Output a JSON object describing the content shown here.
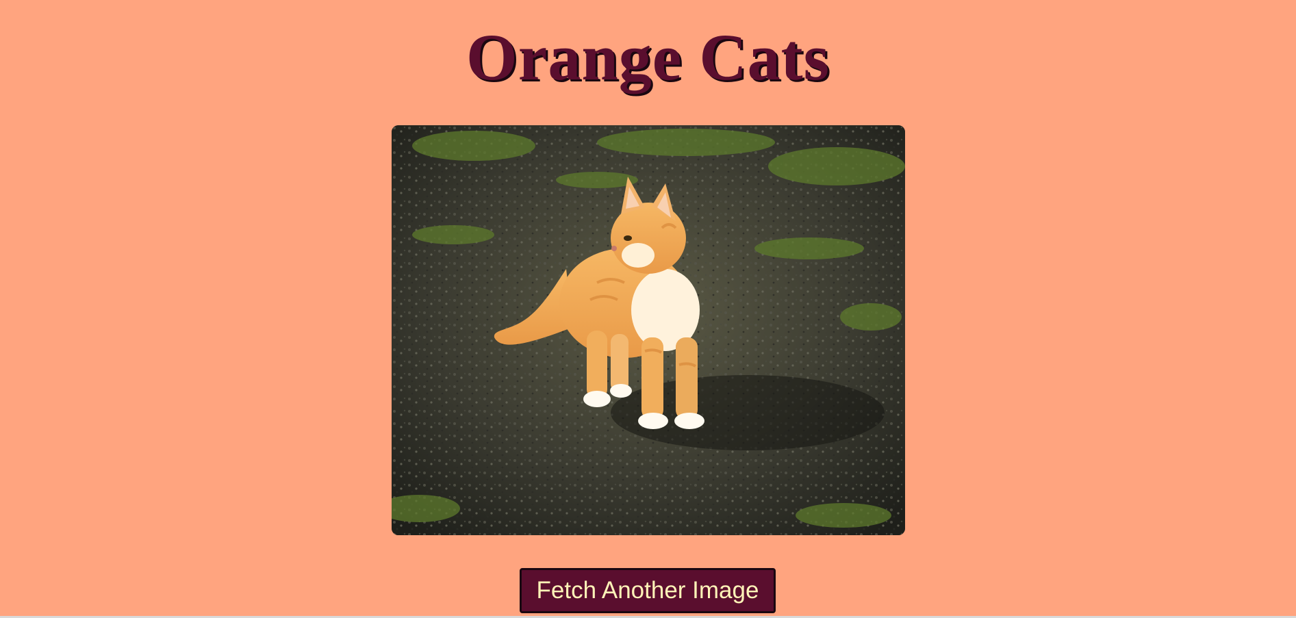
{
  "page": {
    "title": "Orange Cats",
    "background_color": "#FFA47F",
    "accent_color": "#5A0E2E"
  },
  "image": {
    "subject": "orange-kitten-photo"
  },
  "actions": {
    "fetch_label": "Fetch Another Image"
  }
}
